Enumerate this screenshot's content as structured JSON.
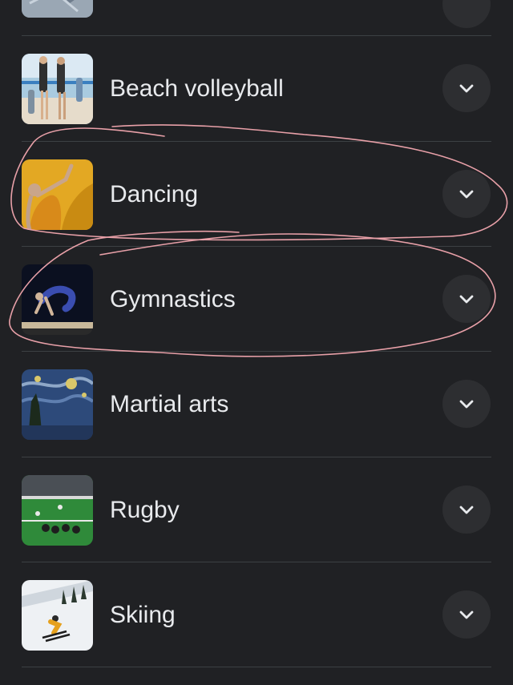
{
  "list": {
    "items": [
      {
        "label": "Beach volleyball",
        "thumb_icon": "beach-volleyball-photo",
        "expand_icon": "chevron-down-icon"
      },
      {
        "label": "Dancing",
        "thumb_icon": "dancing-photo",
        "expand_icon": "chevron-down-icon"
      },
      {
        "label": "Gymnastics",
        "thumb_icon": "gymnastics-photo",
        "expand_icon": "chevron-down-icon"
      },
      {
        "label": "Martial arts",
        "thumb_icon": "starry-night-painting",
        "expand_icon": "chevron-down-icon"
      },
      {
        "label": "Rugby",
        "thumb_icon": "rugby-photo",
        "expand_icon": "chevron-down-icon"
      },
      {
        "label": "Skiing",
        "thumb_icon": "skiing-photo",
        "expand_icon": "chevron-down-icon"
      }
    ]
  },
  "annotations": {
    "circled_items": [
      "Dancing",
      "Gymnastics"
    ],
    "stroke_color": "#e8a0a8"
  },
  "colors": {
    "background": "#202124",
    "text": "#e8eaed",
    "divider": "#3c4043",
    "button": "#2d2e31"
  }
}
